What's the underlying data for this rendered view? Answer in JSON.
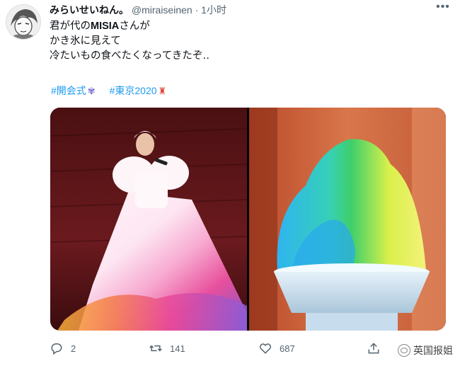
{
  "user": {
    "name": "みらいせいねん。",
    "handle": "@miraiseinen",
    "separator": "·",
    "time": "1小时"
  },
  "tweet": {
    "line1_pre": "君が代の",
    "line1_bold": "MISIA",
    "line1_post": "さんが",
    "line2": "かき氷に見えて",
    "line3": "冷たいもの食べたくなってきたぞ‥"
  },
  "hashtags": [
    {
      "text": "#開会式",
      "emoji": "✾"
    },
    {
      "text": "#東京2020",
      "emoji": "♜"
    }
  ],
  "actions": {
    "reply_count": "2",
    "retweet_count": "141",
    "like_count": "687"
  },
  "watermark": "英国报姐",
  "colors": {
    "link": "#1d9bf0",
    "muted": "#536471"
  }
}
